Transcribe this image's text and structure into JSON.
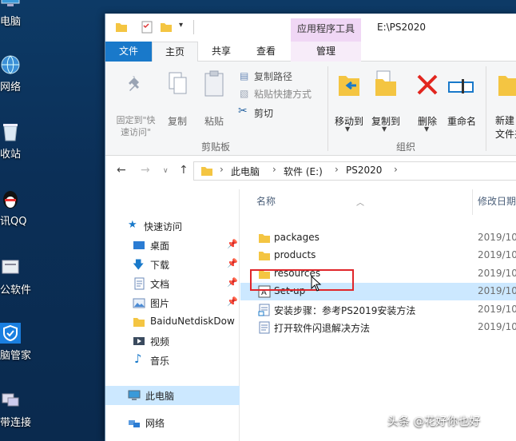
{
  "desktop": {
    "items": [
      {
        "label": "电脑",
        "icon": "computer-icon"
      },
      {
        "label": "网络",
        "icon": "network-icon"
      },
      {
        "label": "收站",
        "icon": "recycle-bin-icon"
      },
      {
        "label": "讯QQ",
        "icon": "qq-penguin-icon"
      },
      {
        "label": "公软件",
        "icon": "office-software-icon"
      },
      {
        "label": "脑管家",
        "icon": "pc-manager-shield-icon"
      },
      {
        "label": "带连接",
        "icon": "broadband-connection-icon"
      }
    ]
  },
  "window": {
    "title": "E:\\PS2020",
    "contextual_tab_header": "应用程序工具",
    "tabs": {
      "file": "文件",
      "home": "主页",
      "share": "共享",
      "view": "查看",
      "manage": "管理"
    },
    "ribbon": {
      "pin_quick_access": "固定到\"快\n速访问\"",
      "copy": "复制",
      "paste": "粘贴",
      "copy_path": "复制路径",
      "paste_shortcut": "粘贴快捷方式",
      "cut": "剪切",
      "clipboard_group": "剪贴板",
      "move_to": "移动到",
      "copy_to": "复制到",
      "delete": "删除",
      "rename": "重命名",
      "organize_group": "组织",
      "new_folder": "新建\n文件夹"
    },
    "address": {
      "crumbs": [
        "此电脑",
        "软件 (E:)",
        "PS2020"
      ]
    },
    "nav": {
      "quick_access": "快速访问",
      "items": [
        {
          "label": "桌面",
          "icon": "desktop-folder-icon",
          "pinned": true
        },
        {
          "label": "下载",
          "icon": "download-arrow-icon",
          "pinned": true
        },
        {
          "label": "文档",
          "icon": "documents-icon",
          "pinned": true
        },
        {
          "label": "图片",
          "icon": "pictures-icon",
          "pinned": true
        },
        {
          "label": "BaiduNetdiskDow",
          "icon": "folder-icon",
          "pinned": false
        },
        {
          "label": "视频",
          "icon": "videos-icon",
          "pinned": false
        },
        {
          "label": "音乐",
          "icon": "music-note-icon",
          "pinned": false
        }
      ],
      "this_pc": "此电脑",
      "network": "网络"
    },
    "columns": {
      "name": "名称",
      "date": "修改日期"
    },
    "files": [
      {
        "name": "packages",
        "date": "2019/10",
        "icon": "folder-icon"
      },
      {
        "name": "products",
        "date": "2019/10",
        "icon": "folder-icon"
      },
      {
        "name": "resources",
        "date": "2019/10",
        "icon": "folder-icon"
      },
      {
        "name": "Set-up",
        "date": "2019/10",
        "icon": "setup-exe-icon",
        "selected": true
      },
      {
        "name": "安装步骤：参考PS2019安装方法",
        "date": "2019/10",
        "icon": "shortcut-doc-icon"
      },
      {
        "name": "打开软件闪退解决方法",
        "date": "2019/10",
        "icon": "text-doc-icon"
      }
    ]
  },
  "watermark": "头条 @花好你也好",
  "colors": {
    "accent": "#1979ca",
    "selection": "#cce8ff",
    "folder": "#f4c542",
    "highlight": "#e0262b",
    "context_tab": "#f0d7f5"
  }
}
